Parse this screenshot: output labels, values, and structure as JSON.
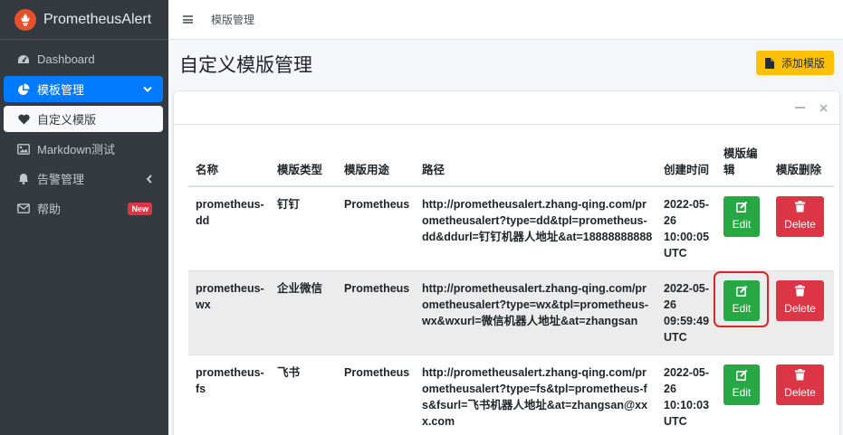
{
  "app": {
    "title": "PrometheusAlert"
  },
  "sidebar": {
    "items": [
      {
        "label": "Dashboard",
        "icon": "tachometer-icon"
      },
      {
        "label": "模板管理",
        "icon": "chart-pie-icon"
      },
      {
        "label": "自定义模版",
        "icon": "heart-icon"
      },
      {
        "label": "Markdown测试",
        "icon": "image-icon"
      },
      {
        "label": "告警管理",
        "icon": "bell-icon"
      },
      {
        "label": "帮助",
        "icon": "envelope-icon",
        "badge": "New"
      }
    ]
  },
  "topbar": {
    "link": "模版管理"
  },
  "page": {
    "title": "自定义模版管理",
    "add_button": "添加模版"
  },
  "table": {
    "headers": [
      "名称",
      "模版类型",
      "模版用途",
      "路径",
      "创建时间",
      "模版编辑",
      "模版删除"
    ],
    "rows": [
      {
        "name": "prometheus-dd",
        "type": "钉钉",
        "use": "Prometheus",
        "path": "http://prometheusalert.zhang-qing.com/prometheusalert?type=dd&tpl=prometheus-dd&ddurl=钉钉机器人地址&at=18888888888",
        "time": "2022-05-26 10:00:05 UTC",
        "edit": "Edit",
        "delete": "Delete"
      },
      {
        "name": "prometheus-wx",
        "type": "企业微信",
        "use": "Prometheus",
        "path": "http://prometheusalert.zhang-qing.com/prometheusalert?type=wx&tpl=prometheus-wx&wxurl=微信机器人地址&at=zhangsan",
        "time": "2022-05-26 09:59:49 UTC",
        "edit": "Edit",
        "delete": "Delete"
      },
      {
        "name": "prometheus-fs",
        "type": "飞书",
        "use": "Prometheus",
        "path": "http://prometheusalert.zhang-qing.com/prometheusalert?type=fs&tpl=prometheus-fs&fsurl=飞书机器人地址&at=zhangsan@xxx.com",
        "time": "2022-05-26 10:10:03 UTC",
        "edit": "Edit",
        "delete": "Delete"
      }
    ]
  },
  "colors": {
    "sidebar_bg": "#343a40",
    "active_blue": "#007bff",
    "add_yellow": "#ffc107",
    "edit_green": "#28a745",
    "delete_red": "#dc3545",
    "highlight": "#dc2626"
  }
}
